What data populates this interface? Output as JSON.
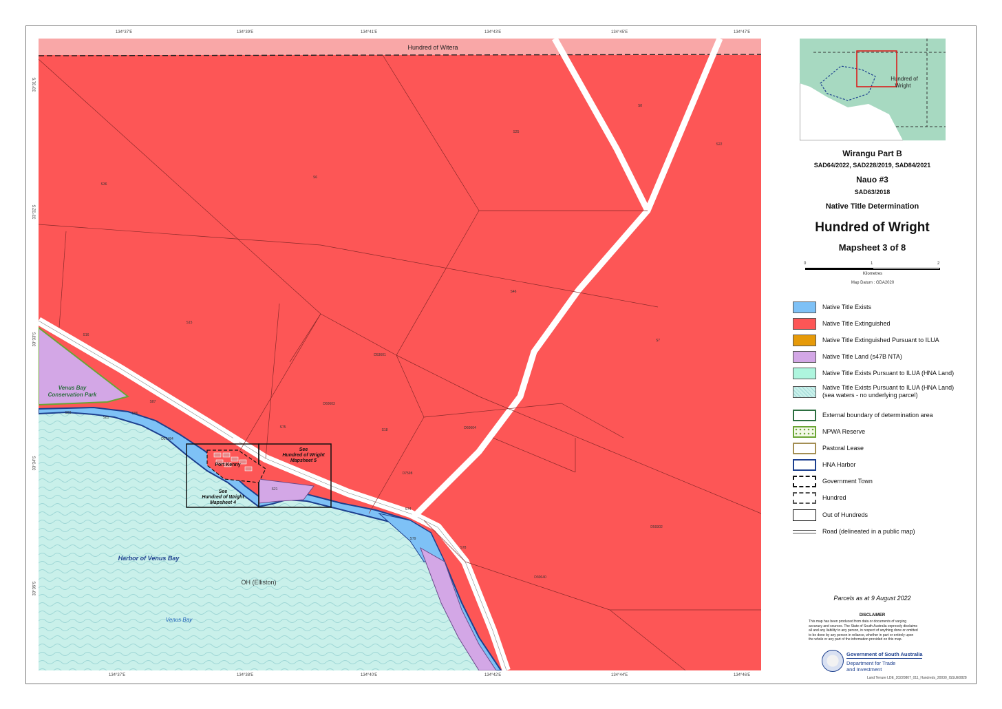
{
  "map": {
    "top_strip_label": "Hundred of Witera",
    "harbor_label": "Harbor of Venus Bay",
    "oh_label": "OH (Elliston)",
    "bay_label": "Venus Bay",
    "park_label_1": "Venus Bay",
    "park_label_2": "Conservation Park",
    "town_label": "Port Kenny",
    "see4_l1": "See",
    "see4_l2": "Hundred of Wright",
    "see4_l3": "Mapsheet 4",
    "see5_l1": "See",
    "see5_l2": "Hundred of Wright",
    "see5_l3": "Mapsheet 5",
    "parcels": [
      "S36",
      "S6",
      "S25",
      "S8",
      "S22",
      "S46",
      "S7",
      "S15",
      "S16",
      "S83",
      "S85",
      "S86",
      "S87",
      "S75",
      "S18",
      "S21",
      "S79",
      "S78",
      "S74",
      "D60603",
      "D60604",
      "D53601",
      "D7598",
      "D30640",
      "D27484",
      "D59302"
    ],
    "ticks_top": [
      "134°37'E",
      "134°39'E",
      "134°41'E",
      "134°43'E",
      "134°45'E",
      "134°47'E"
    ],
    "ticks_bottom": [
      "134°37'E",
      "134°38'E",
      "134°40'E",
      "134°42'E",
      "134°44'E",
      "134°46'E"
    ],
    "ticks_left": [
      "33°31'S",
      "33°32'S",
      "33°33'S",
      "33°34'S",
      "33°35'S"
    ],
    "colors": {
      "extinguished": "#fd5656",
      "exists": "#7ec1f6",
      "ilua_extinguished": "#e69a09",
      "nt_land": "#d3a7e6",
      "hna_land": "#aef5de",
      "sea": "#c9f0ea",
      "harbor_line": "#1c3f8e",
      "boundary": "#2c6e3f",
      "npwa": "#6aa534",
      "pastoral": "#a38e53"
    }
  },
  "sidebar": {
    "title1": "Wirangu Part B",
    "title2": "SAD64/2022, SAD228/2019, SAD84/2021",
    "title3": "Nauo #3",
    "title4": "SAD63/2018",
    "title5": "Native Title Determination",
    "main_title": "Hundred of Wright",
    "mapsheet": "Mapsheet 3 of 8",
    "inset_label_1": "Hundred of",
    "inset_label_2": "Wright",
    "scale_0": "0",
    "scale_1": "1",
    "scale_2": "2",
    "scale_unit": "Kilometres",
    "datum": "Map Datum : GDA2020",
    "legend": [
      {
        "label": "Native Title Exists",
        "icon": "fill-blue"
      },
      {
        "label": "Native Title Extinguished",
        "icon": "fill-red"
      },
      {
        "label": "Native Title Extinguished Pursuant to ILUA",
        "icon": "fill-orange"
      },
      {
        "label": "Native Title Land (s47B NTA)",
        "icon": "fill-purple"
      },
      {
        "label": "Native Title Exists Pursuant to ILUA (HNA Land)",
        "icon": "fill-mint"
      },
      {
        "label": "Native Title Exists Pursuant to ILUA (HNA Land)",
        "label2": "(sea waters - no underlying parcel)",
        "icon": "fill-waves"
      },
      {
        "label": "External boundary of determination area",
        "icon": "green-outline"
      },
      {
        "label": "NPWA Reserve",
        "icon": "npwa-dots"
      },
      {
        "label": "Pastoral Lease",
        "icon": "brown-outline"
      },
      {
        "label": "HNA Harbor",
        "icon": "navy-outline"
      },
      {
        "label": "Government Town",
        "icon": "black-dash"
      },
      {
        "label": "Hundred",
        "icon": "grey-dash"
      },
      {
        "label": "Out of Hundreds",
        "icon": "black-outline"
      },
      {
        "label": "Road (delineated in a public map)",
        "icon": "double-line"
      }
    ],
    "parcels_date": "Parcels as at 9 August 2022",
    "disclaimer_title": "DISCLAIMER",
    "disclaimer_lines": [
      "This map has been produced from data or documents of varying",
      "accuracy and sources. The State of South Australia expressly disclaims",
      "all and any liability to any person, in respect of anything done or omitted",
      "to be done by any person in reliance, whether in part or entirely upon",
      "the whole or any part of the information provided on this map."
    ],
    "gov_name": "Government of South Australia",
    "dept_1": "Department for Trade",
    "dept_2": "and Investment",
    "footer_ref": "Land Tenure LDE_20220807_011_Hundreds_20030_ISSUE0828"
  }
}
